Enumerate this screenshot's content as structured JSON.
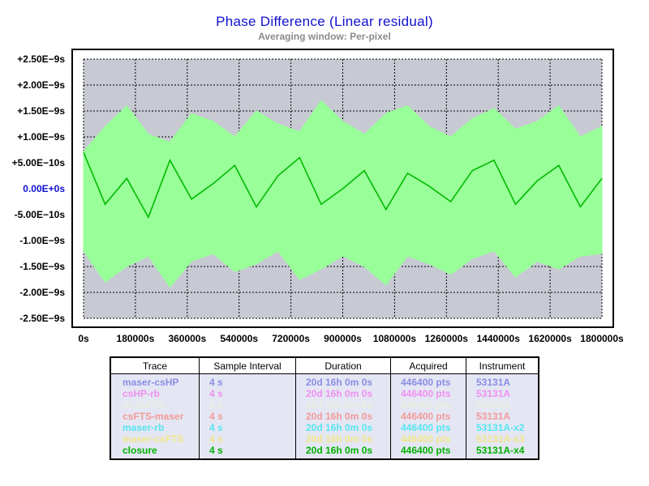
{
  "chart_data": {
    "type": "line",
    "title": "Phase Difference (Linear residual)",
    "subtitle": "Averaging window: Per-pixel",
    "xlim": [
      0,
      1800000
    ],
    "ylim": [
      -2.5e-09,
      2.5e-09
    ],
    "x_ticks": [
      "0s",
      "180000s",
      "360000s",
      "540000s",
      "720000s",
      "900000s",
      "1080000s",
      "1260000s",
      "1440000s",
      "1620000s",
      "1800000s"
    ],
    "y_ticks": [
      "+2.50E−9s",
      "+2.00E−9s",
      "+1.50E−9s",
      "+1.00E−9s",
      "+5.00E−10s",
      "0.00E+0s",
      "-5.00E−10s",
      "-1.00E−9s",
      "-1.50E−9s",
      "-2.00E−9s",
      "-2.50E−9s"
    ],
    "grid": true,
    "series": [
      {
        "name": "closure",
        "role": "envelope",
        "color": "#99ff99",
        "upper": [
          7.2e-10,
          1.2e-09,
          1.6e-09,
          1.05e-09,
          9e-10,
          1.45e-09,
          1.3e-09,
          1e-09,
          1.5e-09,
          1.25e-09,
          1.1e-09,
          1.7e-09,
          1.3e-09,
          1.05e-09,
          1.45e-09,
          1.6e-09,
          1.2e-09,
          1e-09,
          1.35e-09,
          1.55e-09,
          1.15e-09,
          1.3e-09,
          1.6e-09,
          1e-09,
          1.2e-09
        ],
        "lower": [
          -1.2e-09,
          -1.8e-09,
          -1.5e-09,
          -1.3e-09,
          -1.9e-09,
          -1.4e-09,
          -1.25e-09,
          -1.6e-09,
          -1.45e-09,
          -1.2e-09,
          -1.75e-09,
          -1.55e-09,
          -1.3e-09,
          -1.5e-09,
          -1.85e-09,
          -1.3e-09,
          -1.45e-09,
          -1.65e-09,
          -1.35e-09,
          -1.2e-09,
          -1.7e-09,
          -1.4e-09,
          -1.55e-09,
          -1.3e-09,
          -1.25e-09
        ]
      },
      {
        "name": "closure",
        "role": "mean",
        "color": "#00bb00",
        "values": [
          7e-10,
          -3e-10,
          2e-10,
          -5.5e-10,
          5.5e-10,
          -2e-10,
          1e-10,
          4.5e-10,
          -3.5e-10,
          2.5e-10,
          6e-10,
          -3e-10,
          0.0,
          3.5e-10,
          -4e-10,
          3e-10,
          5e-11,
          -2.5e-10,
          3.5e-10,
          5.5e-10,
          -3e-10,
          1.5e-10,
          4.5e-10,
          -3.5e-10,
          2e-10
        ]
      }
    ]
  },
  "legend": {
    "headers": [
      "Trace",
      "Sample Interval",
      "Duration",
      "Acquired",
      "Instrument"
    ],
    "rows": [
      {
        "trace": "maser-csHP",
        "interval": "4 s",
        "duration": "20d 16h 0m 0s",
        "acquired": "446400 pts",
        "instrument": "53131A",
        "color": "#8c8ce6"
      },
      {
        "trace": "csHP-rb",
        "interval": "4 s",
        "duration": "20d 16h 0m 0s",
        "acquired": "446400 pts",
        "instrument": "53131A",
        "color": "#f090f0"
      },
      {
        "trace": "rb-csFTS",
        "interval": "4 s",
        "duration": "20d 16h 0m 0s",
        "acquired": "446400 pts",
        "instrument": "53131A",
        "color": "#e6efdf"
      },
      {
        "trace": "csFTS-maser",
        "interval": "4 s",
        "duration": "20d 16h 0m 0s",
        "acquired": "446400 pts",
        "instrument": "53131A",
        "color": "#f29a9a"
      },
      {
        "trace": "maser-rb",
        "interval": "4 s",
        "duration": "20d 16h 0m 0s",
        "acquired": "446400 pts",
        "instrument": "53131A-x2",
        "color": "#55e6f0"
      },
      {
        "trace": "maser-csFTS",
        "interval": "4 s",
        "duration": "20d 16h 0m 0s",
        "acquired": "446400 pts",
        "instrument": "53131A-x3",
        "color": "#f0e68a"
      },
      {
        "trace": "closure",
        "interval": "4 s",
        "duration": "20d 16h 0m 0s",
        "acquired": "446400 pts",
        "instrument": "53131A-x4",
        "color": "#00b000"
      }
    ]
  }
}
